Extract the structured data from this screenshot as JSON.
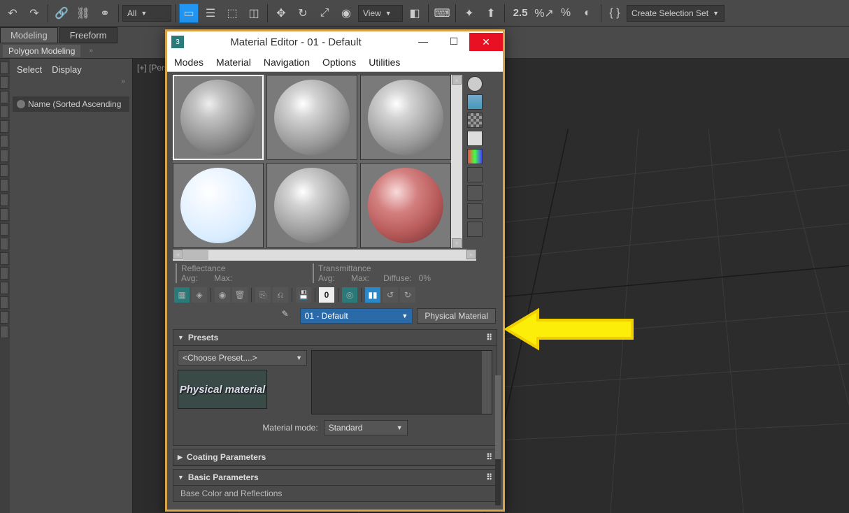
{
  "toolbar": {
    "dropdown1": "All",
    "dropdown2": "View",
    "selection_set": "Create Selection Set",
    "num_label": "2.5"
  },
  "ribbon": {
    "tabs": [
      "Modeling",
      "Freeform"
    ],
    "sub": "Polygon Modeling"
  },
  "scene": {
    "menu": [
      "Select",
      "Display"
    ],
    "sort_label": "Name (Sorted Ascending"
  },
  "viewport": {
    "label": "[+] [Pers"
  },
  "me": {
    "title": "Material Editor - 01 - Default",
    "menus": [
      "Modes",
      "Material",
      "Navigation",
      "Options",
      "Utilities"
    ],
    "info": {
      "reflectance": "Reflectance",
      "transmittance": "Transmittance",
      "avg": "Avg:",
      "max": "Max:",
      "diffuse": "Diffuse:",
      "pct": "0%"
    },
    "zero": "0",
    "material_name": "01 - Default",
    "material_type": "Physical Material",
    "presets": {
      "title": "Presets",
      "choose": "<Choose Preset....>",
      "thumb": "Physical material",
      "mode_label": "Material mode:",
      "mode_value": "Standard"
    },
    "coating": "Coating Parameters",
    "basic": "Basic Parameters",
    "basic_sub": "Base Color and Reflections"
  }
}
